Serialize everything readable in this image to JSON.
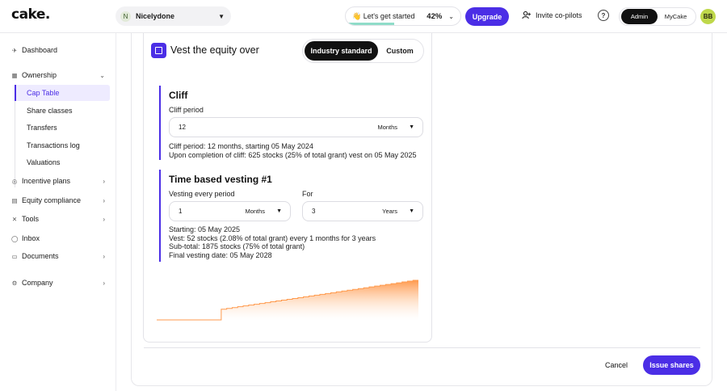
{
  "topbar": {
    "logo": "cake.",
    "company": {
      "initial": "N",
      "name": "Nicelydone"
    },
    "onboarding": {
      "label": "👋 Let's get started",
      "percent_text": "42%",
      "progress": 0.42
    },
    "upgrade_label": "Upgrade",
    "invite_label": "Invite co-pilots",
    "roles": [
      "Admin",
      "MyCake"
    ],
    "active_role": "Admin",
    "user_initials": "BB"
  },
  "sidebar": {
    "dashboard": "Dashboard",
    "ownership": "Ownership",
    "ownership_items": [
      "Cap Table",
      "Share classes",
      "Transfers",
      "Transactions log",
      "Valuations"
    ],
    "active_item": "Cap Table",
    "incentive_plans": "Incentive plans",
    "equity_compliance": "Equity compliance",
    "tools": "Tools",
    "inbox": "Inbox",
    "documents": "Documents",
    "company": "Company"
  },
  "vesting": {
    "title": "Vest the equity over",
    "mode_options": [
      "Industry standard",
      "Custom"
    ],
    "active_mode": "Industry standard",
    "cliff": {
      "heading": "Cliff",
      "period_label": "Cliff period",
      "period_value": "12",
      "period_unit": "Months",
      "desc_line1": "Cliff period: 12 months, starting 05 May 2024",
      "desc_line2": "Upon completion of cliff: 625 stocks (25% of total grant) vest on 05 May 2025"
    },
    "time_based": {
      "heading": "Time based vesting #1",
      "every_label": "Vesting every period",
      "every_value": "1",
      "every_unit": "Months",
      "for_label": "For",
      "for_value": "3",
      "for_unit": "Years",
      "desc_line1": "Starting: 05 May 2025",
      "desc_line2": "Vest: 52 stocks (2.08% of total grant) every 1 months for 3 years",
      "desc_line3": "Sub-total: 1875 stocks (75% of total grant)",
      "desc_line4": "Final vesting date: 05 May 2028"
    }
  },
  "chart_data": {
    "type": "area",
    "title": "",
    "xlabel": "",
    "ylabel": "",
    "x": [
      "05 May 2024",
      "05 May 2025",
      "05 May 2028"
    ],
    "series": [
      {
        "values": [
          0,
          625,
          2500
        ]
      }
    ],
    "steps_after_cliff": 36,
    "ylim": [
      0,
      2500
    ],
    "grid": false,
    "colors": {
      "fill_top": "#ff9a4d",
      "fill_bottom": "#ffffff",
      "line": "#ff9a4d"
    }
  },
  "actions": {
    "cancel": "Cancel",
    "issue": "Issue shares"
  },
  "colors": {
    "brand": "#4b2ee6",
    "accent_soft": "#eeebff"
  }
}
